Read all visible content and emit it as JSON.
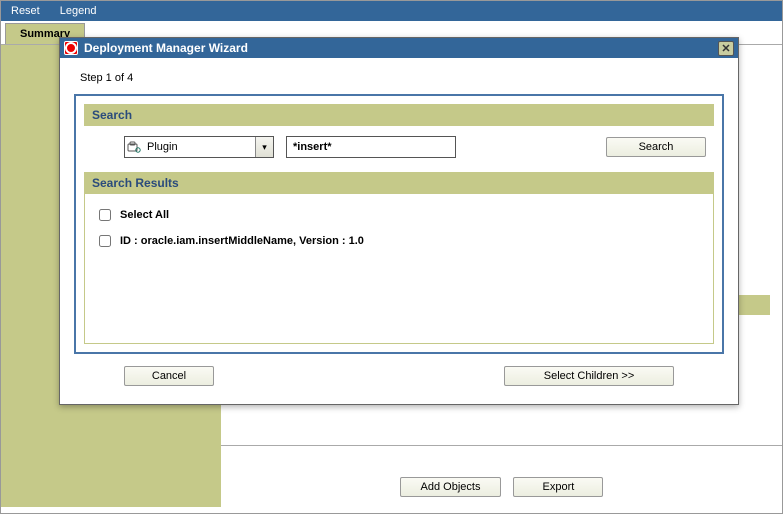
{
  "topbar": {
    "reset": "Reset",
    "legend": "Legend"
  },
  "tab": {
    "summary": "Summary"
  },
  "dialog": {
    "title": "Deployment Manager Wizard",
    "close_glyph": "✕",
    "step": "Step 1 of 4",
    "search_section": "Search",
    "entity_type": "Plugin",
    "entity_icon": "plugin-icon",
    "dropdown_glyph": "▾",
    "search_text": "*insert*",
    "search_btn": "Search",
    "results_section": "Search Results",
    "select_all": "Select All",
    "result_row": "ID : oracle.iam.insertMiddleName, Version : 1.0",
    "cancel_btn": "Cancel",
    "next_btn": "Select Children >>"
  },
  "bottom": {
    "add_objects": "Add Objects",
    "export": "Export"
  }
}
